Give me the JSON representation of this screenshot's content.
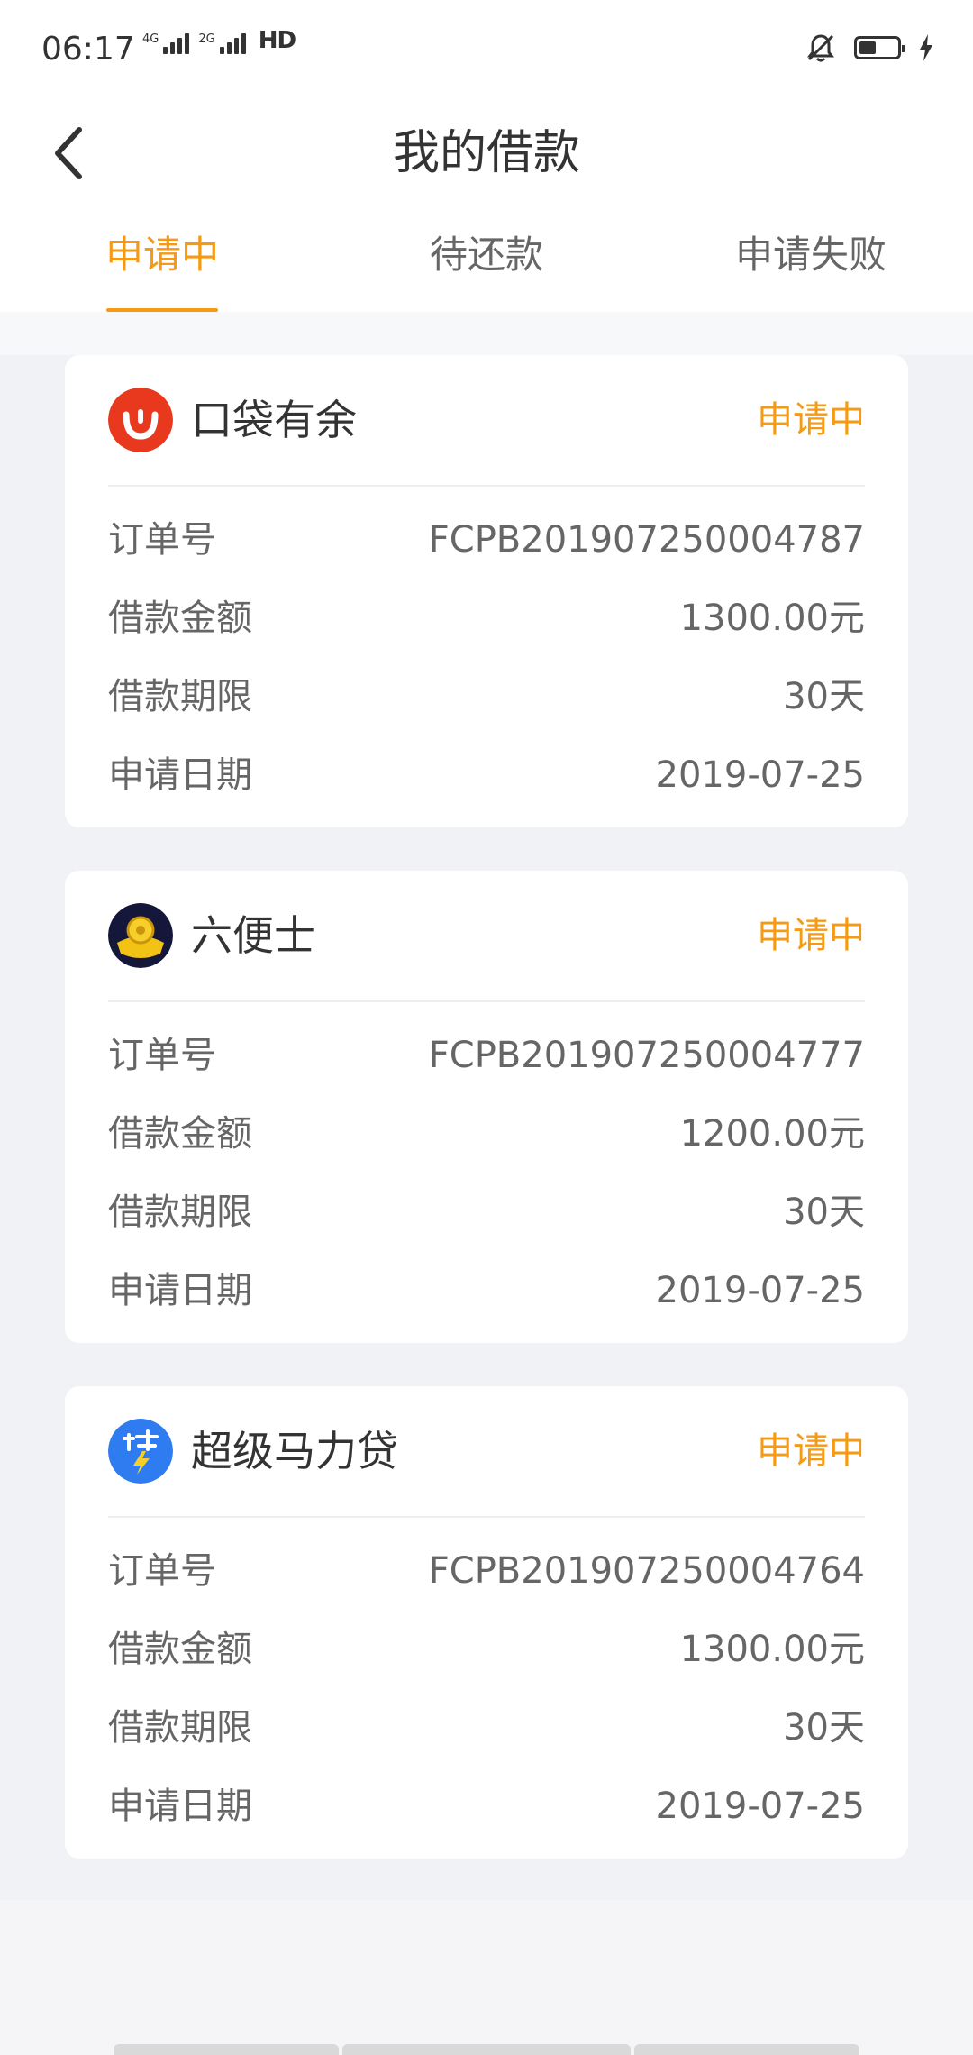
{
  "status_bar": {
    "time": "06:17",
    "network1": "4G",
    "network2": "2G",
    "hd": "HD"
  },
  "header": {
    "title": "我的借款",
    "back_icon": "chevron-left-icon"
  },
  "tabs": [
    {
      "label": "申请中",
      "active": true
    },
    {
      "label": "待还款",
      "active": false
    },
    {
      "label": "申请失败",
      "active": false
    }
  ],
  "colors": {
    "accent": "#f59a12",
    "background": "#f1f2f5"
  },
  "loans": [
    {
      "name": "口袋有余",
      "status": "申请中",
      "logo": "koudai-logo-icon",
      "rows": [
        {
          "label": "订单号",
          "value": "FCPB201907250004787"
        },
        {
          "label": "借款金额",
          "value": "1300.00元"
        },
        {
          "label": "借款期限",
          "value": "30天"
        },
        {
          "label": "申请日期",
          "value": "2019-07-25"
        }
      ]
    },
    {
      "name": "六便士",
      "status": "申请中",
      "logo": "coin-logo-icon",
      "rows": [
        {
          "label": "订单号",
          "value": "FCPB201907250004777"
        },
        {
          "label": "借款金额",
          "value": "1200.00元"
        },
        {
          "label": "借款期限",
          "value": "30天"
        },
        {
          "label": "申请日期",
          "value": "2019-07-25"
        }
      ]
    },
    {
      "name": "超级马力贷",
      "status": "申请中",
      "logo": "dai-logo-icon",
      "rows": [
        {
          "label": "订单号",
          "value": "FCPB201907250004764"
        },
        {
          "label": "借款金额",
          "value": "1300.00元"
        },
        {
          "label": "借款期限",
          "value": "30天"
        },
        {
          "label": "申请日期",
          "value": "2019-07-25"
        }
      ]
    }
  ]
}
